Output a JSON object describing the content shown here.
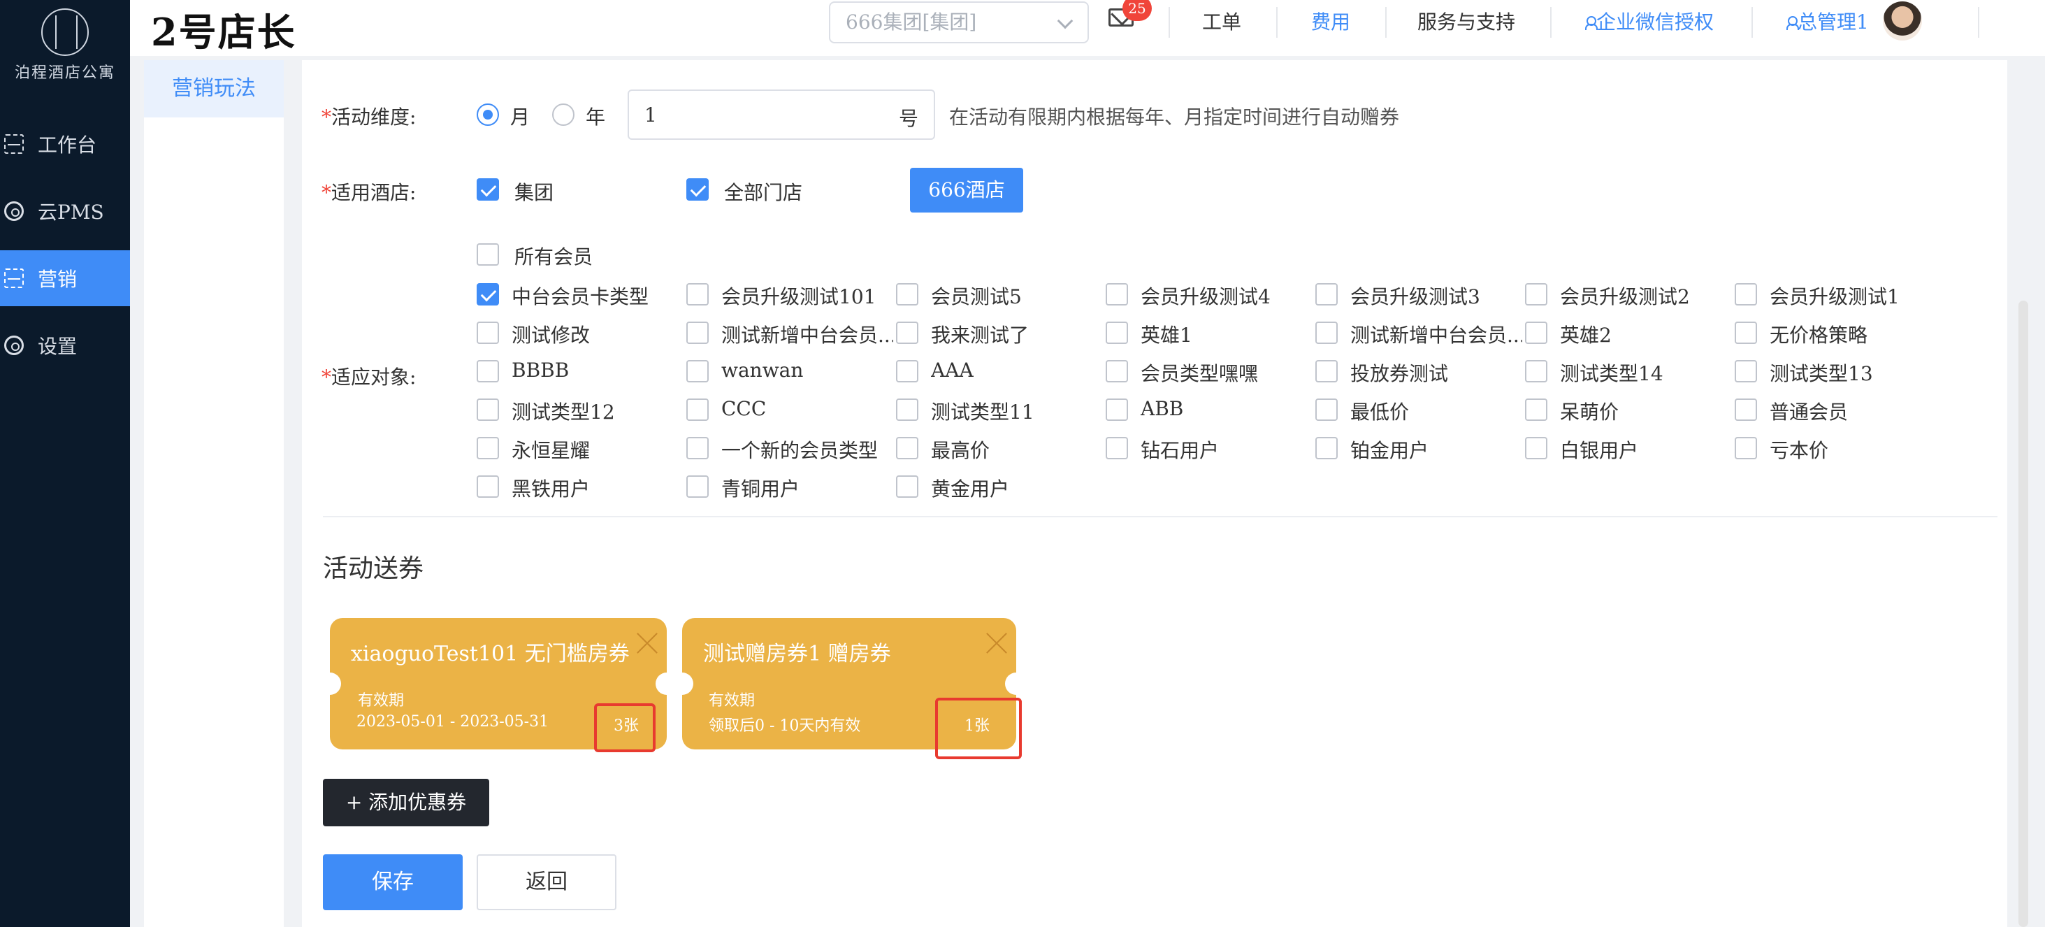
{
  "sidebar": {
    "logo_text": "泊程酒店公寓",
    "items": [
      {
        "label": "工作台"
      },
      {
        "label": "云PMS"
      },
      {
        "label": "营销"
      },
      {
        "label": "设置"
      }
    ]
  },
  "header": {
    "brand": "2号店长",
    "group_select": "666集团[集团]",
    "mail_badge": "25",
    "nav": {
      "work_order": "工单",
      "fees": "费用",
      "service": "服务与支持",
      "wechat_auth": "企业微信授权",
      "admin": "总管理1"
    }
  },
  "subnav": {
    "active": "营销玩法"
  },
  "form": {
    "dimension": {
      "label": "活动维度:",
      "month": "月",
      "year": "年",
      "selected": "月",
      "value": "1",
      "suffix": "号",
      "hint": "在活动有限期内根据每年、月指定时间进行自动赠券"
    },
    "hotels": {
      "label": "适用酒店:",
      "group": "集团",
      "all_stores": "全部门店",
      "hotel_button": "666酒店"
    },
    "targets": {
      "label": "适应对象:",
      "all_members": "所有会员",
      "options": [
        {
          "label": "中台会员卡类型",
          "checked": true
        },
        {
          "label": "会员升级测试101",
          "checked": false
        },
        {
          "label": "会员测试5",
          "checked": false
        },
        {
          "label": "会员升级测试4",
          "checked": false
        },
        {
          "label": "会员升级测试3",
          "checked": false
        },
        {
          "label": "会员升级测试2",
          "checked": false
        },
        {
          "label": "会员升级测试1",
          "checked": false
        },
        {
          "label": "测试修改",
          "checked": false
        },
        {
          "label": "测试新增中台会员...",
          "checked": false
        },
        {
          "label": "我来测试了",
          "checked": false
        },
        {
          "label": "英雄1",
          "checked": false
        },
        {
          "label": "测试新增中台会员...",
          "checked": false
        },
        {
          "label": "英雄2",
          "checked": false
        },
        {
          "label": "无价格策略",
          "checked": false
        },
        {
          "label": "BBBB",
          "checked": false
        },
        {
          "label": "wanwan",
          "checked": false
        },
        {
          "label": "AAA",
          "checked": false
        },
        {
          "label": "会员类型嘿嘿",
          "checked": false
        },
        {
          "label": "投放券测试",
          "checked": false
        },
        {
          "label": "测试类型14",
          "checked": false
        },
        {
          "label": "测试类型13",
          "checked": false
        },
        {
          "label": "测试类型12",
          "checked": false
        },
        {
          "label": "CCC",
          "checked": false
        },
        {
          "label": "测试类型11",
          "checked": false
        },
        {
          "label": "ABB",
          "checked": false
        },
        {
          "label": "最低价",
          "checked": false
        },
        {
          "label": "呆萌价",
          "checked": false
        },
        {
          "label": "普通会员",
          "checked": false
        },
        {
          "label": "永恒星耀",
          "checked": false
        },
        {
          "label": "一个新的会员类型",
          "checked": false
        },
        {
          "label": "最高价",
          "checked": false
        },
        {
          "label": "钻石用户",
          "checked": false
        },
        {
          "label": "铂金用户",
          "checked": false
        },
        {
          "label": "白银用户",
          "checked": false
        },
        {
          "label": "亏本价",
          "checked": false
        },
        {
          "label": "黑铁用户",
          "checked": false
        },
        {
          "label": "青铜用户",
          "checked": false
        },
        {
          "label": "黄金用户",
          "checked": false
        }
      ]
    }
  },
  "coupons_section": {
    "title": "活动送券",
    "coupons": [
      {
        "title": "xiaoguoTest101 无门槛房券",
        "valid_label": "有效期",
        "valid": "2023-05-01 - 2023-05-31",
        "count": "3张"
      },
      {
        "title": "测试赠房券1 赠房券",
        "valid_label": "有效期",
        "valid": "领取后0 - 10天内有效",
        "count": "1张"
      }
    ],
    "add_button": "+ 添加优惠券"
  },
  "actions": {
    "save": "保存",
    "back": "返回"
  },
  "colors": {
    "accent": "#3f8cf7",
    "sidebar": "#0b1a2b",
    "coupon": "#ebb346",
    "highlight": "#e83a2f"
  }
}
